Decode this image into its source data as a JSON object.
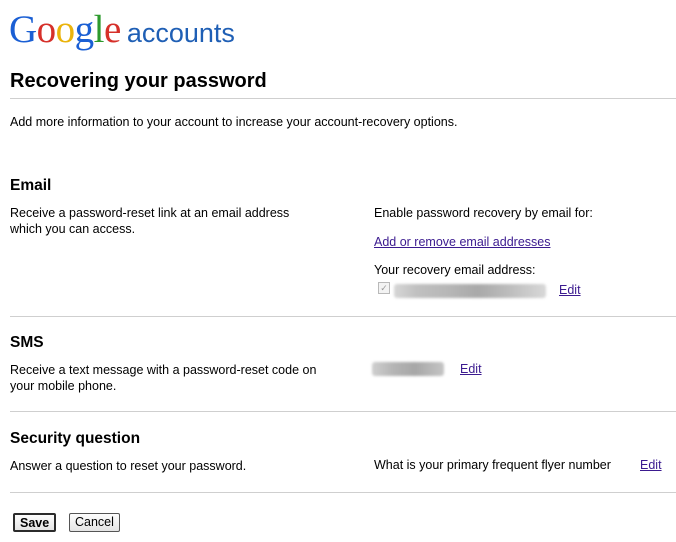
{
  "header": {
    "logo_letters": [
      {
        "char": "G",
        "color": "#1a5fd4"
      },
      {
        "char": "o",
        "color": "#d6302a"
      },
      {
        "char": "o",
        "color": "#eab30b"
      },
      {
        "char": "g",
        "color": "#1a5fd4"
      },
      {
        "char": "l",
        "color": "#2d9a2d"
      },
      {
        "char": "e",
        "color": "#d6302a"
      }
    ],
    "logo_text": "Google",
    "accounts_label": "accounts"
  },
  "page": {
    "title": "Recovering your password",
    "intro": "Add more information to your account to increase your account-recovery options."
  },
  "email_section": {
    "title": "Email",
    "description": "Receive a password-reset link at an email address which you can access.",
    "enable_text": "Enable password recovery by email for:",
    "add_remove_link": "Add or remove email addresses",
    "recovery_label": "Your recovery email address:",
    "checkbox_checked": true,
    "edit_link": "Edit"
  },
  "sms_section": {
    "title": "SMS",
    "description": "Receive a text message with a password-reset code on your mobile phone.",
    "edit_link": "Edit"
  },
  "security_section": {
    "title": "Security question",
    "description": "Answer a question to reset your password.",
    "question": "What is your primary frequent flyer number",
    "edit_link": "Edit"
  },
  "actions": {
    "save_label": "Save",
    "cancel_label": "Cancel"
  }
}
